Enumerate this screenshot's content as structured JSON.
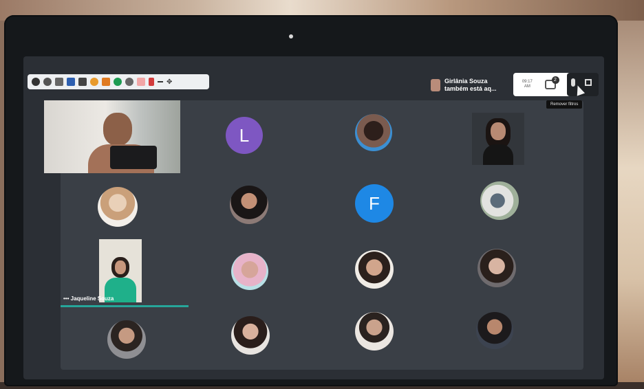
{
  "notification": {
    "name": "Girlânia Souza",
    "message": "também está aq..."
  },
  "controls": {
    "time_line1": "09:17",
    "time_line2": "AM",
    "chat_badge": "2",
    "tooltip": "Remover filtros"
  },
  "participants_letters": [
    {
      "letter": "L",
      "color": "#7e57c2"
    },
    {
      "letter": "F",
      "color": "#1e88e5"
    }
  ],
  "speaker": {
    "name": "Jaqueline Souza",
    "dots": "•••"
  },
  "ext_icons": [
    "info-icon",
    "shield-icon",
    "volume-icon",
    "brush-icon",
    "list-icon",
    "emoji-icon",
    "translate-icon",
    "circle-icon",
    "gear-icon",
    "flag-icon",
    "minus-icon",
    "move-icon"
  ],
  "colors": {
    "tile_bg": "#3a3f46",
    "screen_bg": "#2b2f35",
    "accent": "#26a69a"
  }
}
